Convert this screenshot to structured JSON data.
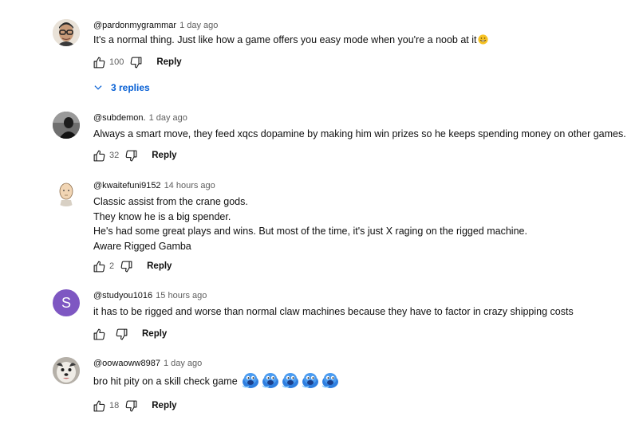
{
  "comments": [
    {
      "author": "@pardonmygrammar",
      "time": "1 day ago",
      "lines": [
        "It's a normal thing. Just like how a game offers you easy mode when you're a noob at it"
      ],
      "emoji": "grinning-face-emoji",
      "likes": "100",
      "reply_label": "Reply",
      "replies_label": "3 replies",
      "avatar": "photo-glasses-man"
    },
    {
      "author": "@subdemon.",
      "time": "1 day ago",
      "lines": [
        "Always a smart move, they feed xqcs dopamine by making him win prizes so he keeps spending money on other games."
      ],
      "likes": "32",
      "reply_label": "Reply",
      "avatar": "photo-dark-figure"
    },
    {
      "author": "@kwaitefuni9152",
      "time": "14 hours ago",
      "lines": [
        "Classic assist from the crane gods.",
        "They know he is a big spender.",
        "He's had some great plays and wins. But most of the time, it's just X raging on the rigged machine.",
        "Aware Rigged Gamba"
      ],
      "likes": "2",
      "reply_label": "Reply",
      "avatar": "illustration-bald-head"
    },
    {
      "author": "@studyou1016",
      "time": "15 hours ago",
      "lines": [
        "it has to be rigged and worse than normal claw machines because they have to factor in crazy shipping costs"
      ],
      "likes": "",
      "reply_label": "Reply",
      "avatar_letter": "S",
      "avatar_color": "#7e57c2"
    },
    {
      "author": "@oowaoww8987",
      "time": "1 day ago",
      "lines": [
        "bro hit pity on a skill check game"
      ],
      "emoji_row": [
        "blue-blob-emoji",
        "blue-blob-emoji",
        "blue-blob-emoji",
        "blue-blob-emoji",
        "blue-blob-emoji"
      ],
      "likes": "18",
      "reply_label": "Reply",
      "avatar": "photo-dog"
    }
  ],
  "icons": {
    "like": "thumbs-up-icon",
    "dislike": "thumbs-down-icon",
    "expand": "chevron-down-icon"
  },
  "colors": {
    "link_blue": "#065fd4",
    "secondary_text": "#606060",
    "avatar_s": "#7e57c2"
  }
}
